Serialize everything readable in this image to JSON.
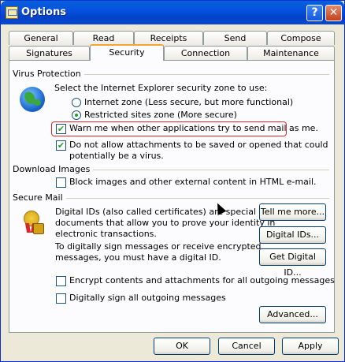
{
  "window": {
    "title": "Options",
    "help_label": "?",
    "close_label": "✕"
  },
  "tabs_row1": [
    "General",
    "Read",
    "Receipts",
    "Send",
    "Compose"
  ],
  "tabs_row2": [
    "Signatures",
    "Security",
    "Connection",
    "Maintenance"
  ],
  "active_tab": "Security",
  "virus_protection": {
    "heading": "Virus Protection",
    "zone_prompt": "Select the Internet Explorer security zone to use:",
    "internet_zone_label": "Internet zone (Less secure, but more functional)",
    "restricted_zone_label": "Restricted sites zone (More secure)",
    "selected_zone": "restricted",
    "warn_label": "Warn me when other applications try to send mail as me.",
    "warn_checked": true,
    "attachments_label_line1": "Do not allow attachments to be saved or opened that could",
    "attachments_label_line2": "potentially be a virus.",
    "attachments_checked": true
  },
  "download_images": {
    "heading": "Download Images",
    "block_label": "Block images and other external content in HTML e-mail.",
    "block_checked": false
  },
  "secure_mail": {
    "heading": "Secure Mail",
    "desc_line1": "Digital IDs (also called certificates) are special",
    "desc_line2": "documents that allow you to prove your identity in",
    "desc_line3": "electronic transactions.",
    "desc_line4": "To digitally sign messages or receive encrypted",
    "desc_line5": "messages, you must have a digital ID.",
    "tell_me_more": "Tell me more...",
    "digital_ids": "Digital IDs...",
    "get_digital_id": "Get Digital ID...",
    "encrypt_label": "Encrypt contents and attachments for all outgoing messages",
    "encrypt_checked": false,
    "sign_label": "Digitally sign all outgoing messages",
    "sign_checked": false,
    "advanced": "Advanced..."
  },
  "footer": {
    "ok": "OK",
    "cancel": "Cancel",
    "apply": "Apply"
  }
}
